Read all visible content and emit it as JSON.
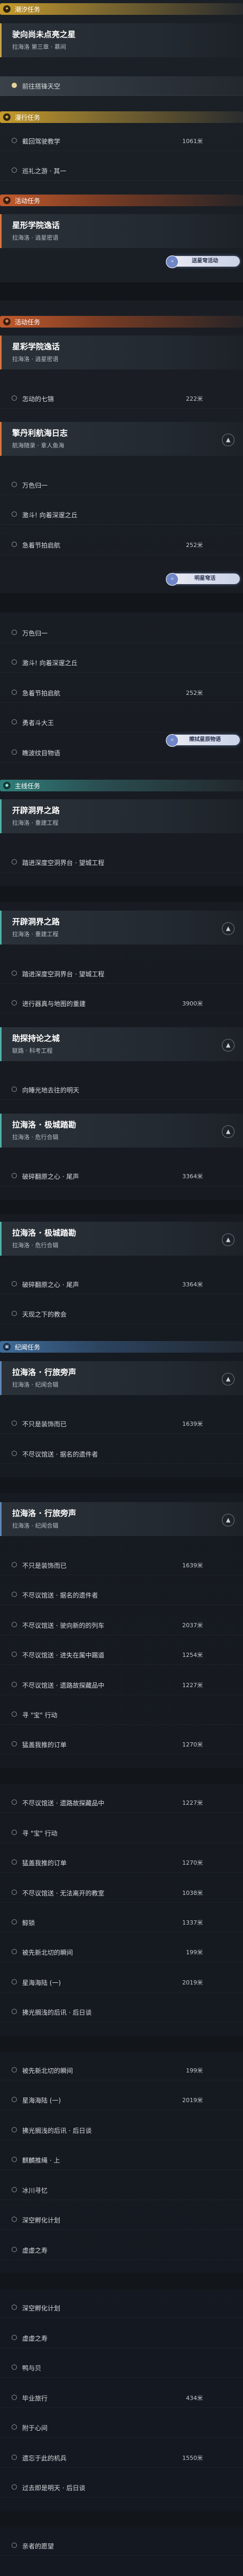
{
  "sections": {
    "tide": "潮汐任务",
    "roaming": "漫行任务",
    "activity": "活动任务",
    "activity2": "活动任务",
    "main": "主线任务",
    "memory": "纪闻任务"
  },
  "badges": {
    "limited": "送星穹活动",
    "limited2": "明星穹活",
    "recommend": "擦拭星辰物语"
  },
  "cards": {
    "c1": {
      "title": "驶向尚未点亮之星",
      "sub": "拉海洛 第三章 · 慕间"
    },
    "c2": {
      "title": "星形学院逸话",
      "sub": "拉海洛 · 逍星密语"
    },
    "c3": {
      "title": "星彩学院逸话",
      "sub": "拉海洛 · 逍星密语"
    },
    "c4": {
      "title": "擎丹利航海日志",
      "sub": "航海随录 · 拿人鱼海"
    },
    "c5": {
      "title": "开辟洞界之路",
      "sub": "拉海洛 · 重建工程"
    },
    "c6": {
      "title": "开辟洞界之路",
      "sub": "拉海洛 · 重建工程"
    },
    "c7": {
      "title": "助探持论之城",
      "sub": "联路 · 科考工程"
    },
    "c8": {
      "title": "拉海洛 · 极城踏勘",
      "sub": "拉海洛 · 危行合辑"
    },
    "c9": {
      "title": "拉海洛 · 极城踏勘",
      "sub": "拉海洛 · 危行合辑"
    },
    "c10": {
      "title": "拉海洛 · 行旅旁声",
      "sub": "拉海洛 · 纪闻合辑"
    },
    "c11": {
      "title": "拉海洛 · 行旅旁声",
      "sub": "拉海洛 · 纪闻合辑"
    }
  },
  "rows": {
    "r1": {
      "text": "前往搭锋天空"
    },
    "r2": {
      "text": "截回驾驶教学",
      "dist": "1061米"
    },
    "r3": {
      "text": "巡礼之游 · 其一"
    },
    "r4": {
      "text": "怎动的七锦",
      "dist": "222米"
    },
    "r5": {
      "text": "万色归一"
    },
    "r6": {
      "text": "激斗! 向着深邃之丘"
    },
    "r7": {
      "text": "急着节拍启航",
      "dist": "252米"
    },
    "r8": {
      "text": "万色归一"
    },
    "r9": {
      "text": "激斗! 向着深邃之丘"
    },
    "r10": {
      "text": "急着节拍启航",
      "dist": "252米"
    },
    "r11": {
      "text": "勇者斗大王"
    },
    "r12": {
      "text": "瞧波纹目物语"
    },
    "r13": {
      "text": "踏进深度空洞界台 · 望城工程"
    },
    "r14": {
      "text": "踏进深度空洞界台 · 望城工程"
    },
    "r15": {
      "text": "进行器真与地图的重建",
      "dist": "3900米"
    },
    "r16": {
      "text": "向睡光地去往的明天"
    },
    "r17": {
      "text": "破碎翻原之心 · 尾声",
      "dist": "3364米"
    },
    "r18": {
      "text": "破碎翻原之心 · 尾声",
      "dist": "3364米"
    },
    "r19": {
      "text": "天现之下的教会"
    },
    "r20": {
      "text": "不只是装饰而已",
      "dist": "1639米"
    },
    "r21": {
      "text": "不尽议馆送 · 据名的遗件者"
    },
    "r22": {
      "text": "不只是装饰而已",
      "dist": "1639米"
    },
    "r23": {
      "text": "不尽议馆送 · 据名的遗件者"
    },
    "r24": {
      "text": "不尽议馆送 · 驶向新的的列车",
      "dist": "2037米"
    },
    "r25": {
      "text": "不尽议馆送 · 进失在属中踢道",
      "dist": "1254米"
    },
    "r26": {
      "text": "不尽议馆送 · 遗路故探藏品中",
      "dist": "1227米"
    },
    "r27": {
      "text": "寻 \"宝\" 行动"
    },
    "r28": {
      "text": "猛盖我推的订单",
      "dist": "1270米"
    },
    "r29": {
      "text": "不尽议馆送 · 遗路故探藏品中",
      "dist": "1227米"
    },
    "r30": {
      "text": "寻 \"宝\" 行动"
    },
    "r31": {
      "text": "猛盖我推的订单",
      "dist": "1270米"
    },
    "r32": {
      "text": "不尽议馆送 · 无法离开的教室",
      "dist": "1038米"
    },
    "r33": {
      "text": "鲸锁",
      "dist": "1337米"
    },
    "r34": {
      "text": "被先新北切的瞬间",
      "dist": "199米"
    },
    "r35": {
      "text": "星海海陆 (一)",
      "dist": "2019米"
    },
    "r36": {
      "text": "拂光搁浅的后讯 · 后日谈"
    },
    "r37": {
      "text": "被先新北切的瞬间",
      "dist": "199米"
    },
    "r38": {
      "text": "星海海陆 (一)",
      "dist": "2019米"
    },
    "r39": {
      "text": "拂光搁浅的后讯 · 后日谈"
    },
    "r40": {
      "text": "麒麟推绳 · 上"
    },
    "r41": {
      "text": "冰川寻忆"
    },
    "r42": {
      "text": "深空孵化计划"
    },
    "r43": {
      "text": "虚虚之寿"
    },
    "r44": {
      "text": "深空孵化计划"
    },
    "r45": {
      "text": "虚虚之寿"
    },
    "r46": {
      "text": "鸭与贝"
    },
    "r47": {
      "text": "毕业旅行",
      "dist": "434米"
    },
    "r48": {
      "text": "附于心间"
    },
    "r49": {
      "text": "遗忘于此的机兵",
      "dist": "1550米"
    },
    "r50": {
      "text": "过去即是明天 · 后日谈"
    },
    "r51": {
      "text": "亲者的愿望"
    }
  }
}
